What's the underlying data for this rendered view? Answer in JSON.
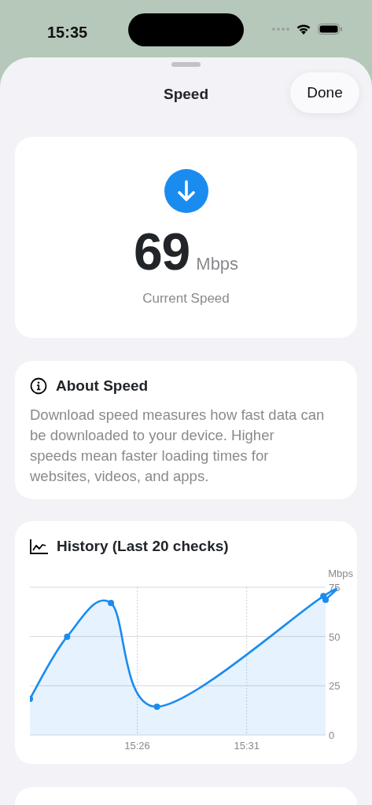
{
  "status_bar": {
    "time": "15:35"
  },
  "sheet": {
    "title": "Speed",
    "done_button": "Done"
  },
  "current": {
    "value": "69",
    "unit": "Mbps",
    "caption": "Current Speed"
  },
  "about": {
    "title": "About Speed",
    "text": "Download speed measures how fast data can be downloaded to your device. Higher speeds mean faster loading times for websites, videos, and apps."
  },
  "history": {
    "title": "History (Last 20 checks)",
    "chart_data": {
      "type": "area",
      "ylabel": "Mbps",
      "x": [
        921.1,
        922.8,
        924.8,
        926.9,
        934.5,
        934.6
      ],
      "series": [
        {
          "color": "#1a8cf0",
          "values": [
            18.4,
            49.9,
            67,
            14.4,
            70.5,
            68.6
          ]
        }
      ],
      "xlim": [
        921.1,
        934.6
      ],
      "grid": true,
      "ylim": [
        0,
        75
      ],
      "yticks": [
        0,
        25,
        50,
        75
      ],
      "xticks": [
        {
          "value": 926,
          "label": "15:26"
        },
        {
          "value": 931,
          "label": "15:31"
        }
      ]
    }
  }
}
